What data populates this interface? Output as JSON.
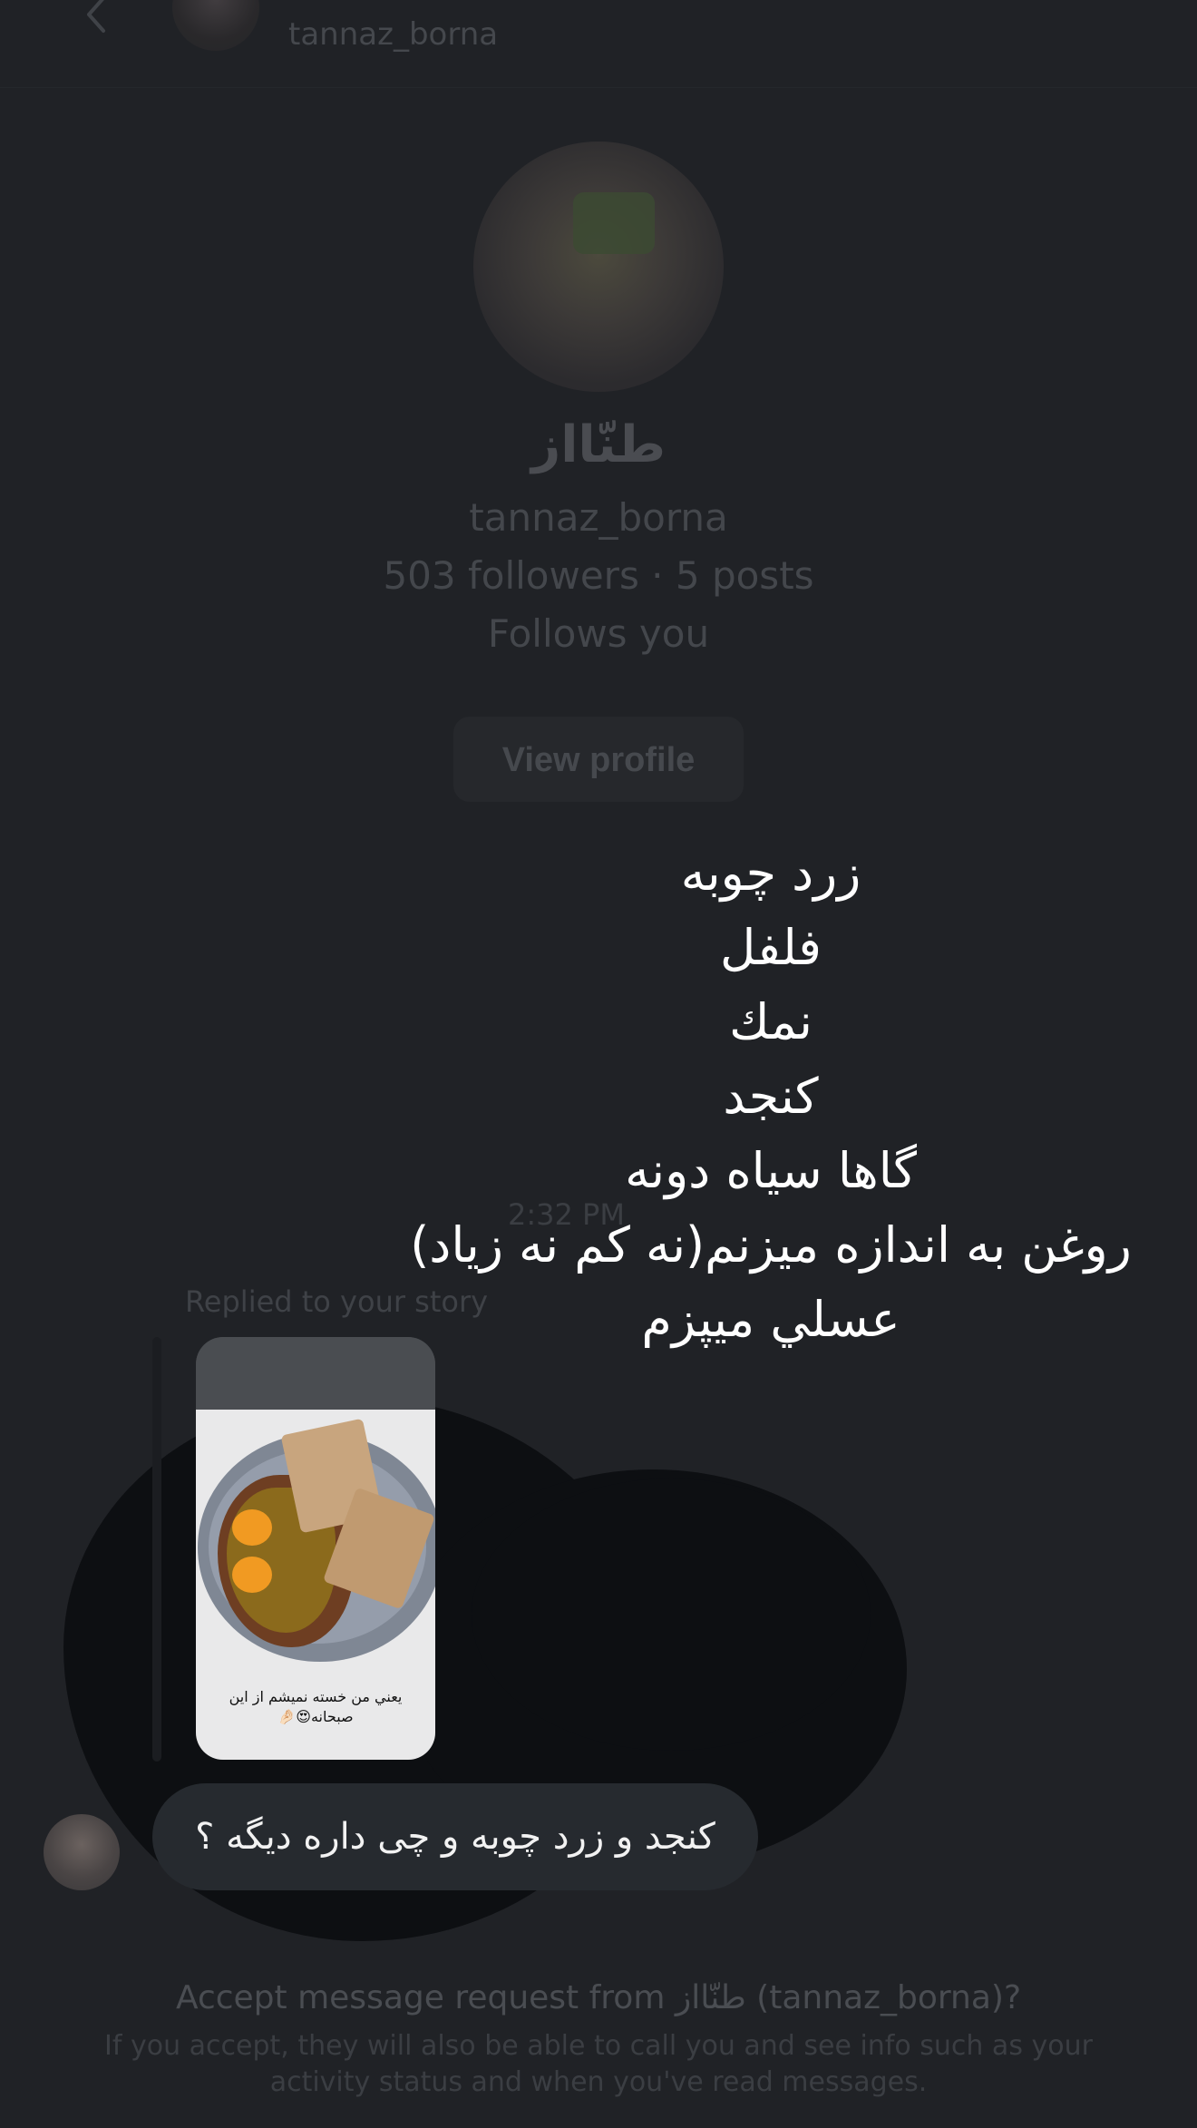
{
  "header": {
    "username": "tannaz_borna",
    "back_icon": "chevron-left-icon"
  },
  "profile": {
    "display_name": "طنّااز",
    "username": "tannaz_borna",
    "stats": "503 followers · 5 posts",
    "follow_status": "Follows you",
    "view_profile_label": "View profile"
  },
  "story_overlay_lines": [
    "زرد چوبه",
    "فلفل",
    "نمك",
    "كنجد",
    "گاها سياه دونه",
    "روغن به اندازه ميزنم(نه كم نه زياد)",
    "عسلي ميپزم"
  ],
  "thread": {
    "timestamp": "2:32 PM",
    "replied_label": "Replied to your story",
    "story_caption": "يعني من خسته نميشم از اين صبحانه😍🤌🏻",
    "message": "كنجد و زرد چوبه و چی داره دیگه ؟"
  },
  "request": {
    "title": "Accept message request from طنّااز (tannaz_borna)?",
    "body": "If you accept, they will also be able to call you and see info such as your activity status and when you've read messages."
  },
  "colors": {
    "background": "#202226",
    "bubble": "#262a2f",
    "dimmed_text": "#45484d",
    "overlay_text": "#ffffff"
  }
}
